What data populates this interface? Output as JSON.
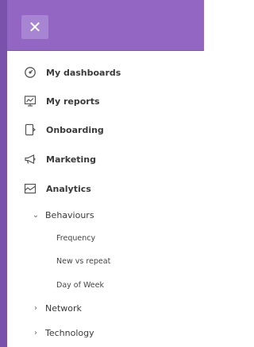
{
  "header": {
    "close_icon": "close-icon",
    "close_glyph": "✕",
    "background": "#9466c4",
    "accent": "#7b52ab"
  },
  "menu": {
    "items": [
      {
        "label": "My dashboards",
        "icon": "gauge-icon"
      },
      {
        "label": "My reports",
        "icon": "chart-screen-icon"
      },
      {
        "label": "Onboarding",
        "icon": "onboarding-icon"
      },
      {
        "label": "Marketing",
        "icon": "megaphone-icon"
      },
      {
        "label": "Analytics",
        "icon": "line-chart-icon"
      }
    ],
    "analytics_children": [
      {
        "label": "Behaviours",
        "expanded": true,
        "chevron": "⌄",
        "children": [
          "Frequency",
          "New vs repeat",
          "Day of Week"
        ]
      },
      {
        "label": "Network",
        "expanded": false,
        "chevron": "›"
      },
      {
        "label": "Technology",
        "expanded": false,
        "chevron": "›"
      }
    ]
  }
}
